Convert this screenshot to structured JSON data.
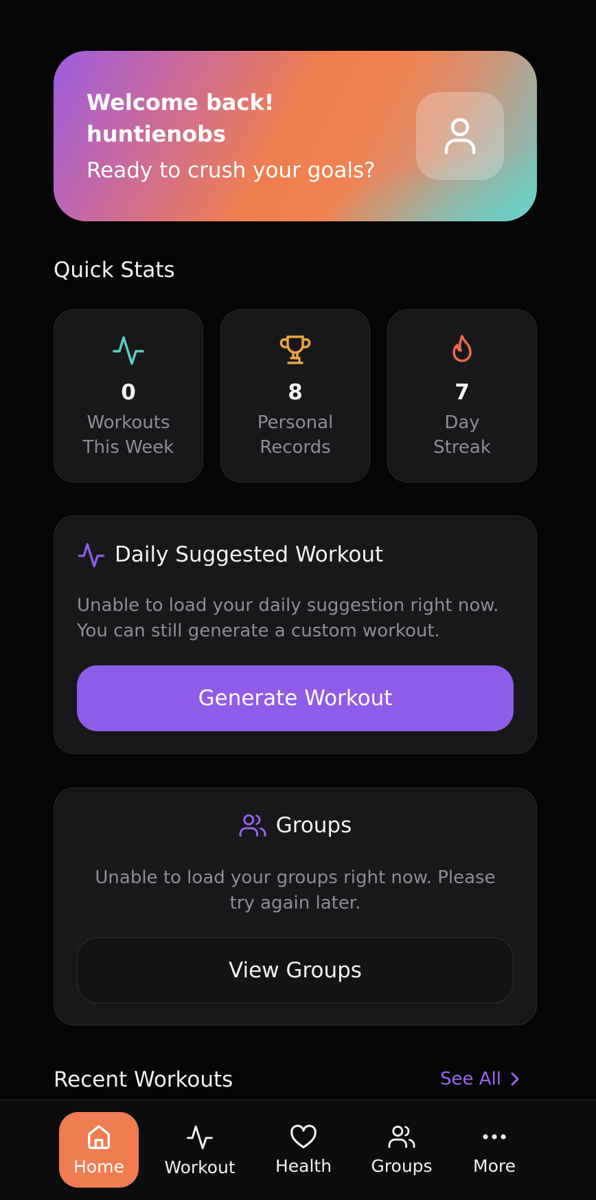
{
  "welcome": {
    "title": "Welcome back! huntienobs",
    "subtitle": "Ready to crush your goals?",
    "avatar_icon": "user-icon"
  },
  "quick_stats": {
    "title": "Quick Stats",
    "items": [
      {
        "value": "0",
        "label": "Workouts This Week",
        "icon": "activity-icon",
        "color": "#5ccfc7"
      },
      {
        "value": "8",
        "label": "Personal Records",
        "icon": "trophy-icon",
        "color": "#eba544"
      },
      {
        "value": "7",
        "label": "Day Streak",
        "icon": "flame-icon",
        "color": "#ef6a4a"
      }
    ]
  },
  "daily": {
    "title": "Daily Suggested Workout",
    "message": "Unable to load your daily suggestion right now. You can still generate a custom workout.",
    "button": "Generate Workout",
    "icon": "activity-icon",
    "accent": "#8f5cea"
  },
  "groups": {
    "title": "Groups",
    "message": "Unable to load your groups right now. Please try again later.",
    "button": "View Groups",
    "icon": "users-icon"
  },
  "recent": {
    "title": "Recent Workouts",
    "see_all": "See All"
  },
  "nav": {
    "active_color": "#f07d52",
    "items": [
      {
        "label": "Home",
        "icon": "home-icon",
        "active": true
      },
      {
        "label": "Workout",
        "icon": "activity-icon",
        "active": false
      },
      {
        "label": "Health",
        "icon": "heart-icon",
        "active": false
      },
      {
        "label": "Groups",
        "icon": "users-icon",
        "active": false
      },
      {
        "label": "More",
        "icon": "more-icon",
        "active": false
      }
    ]
  }
}
